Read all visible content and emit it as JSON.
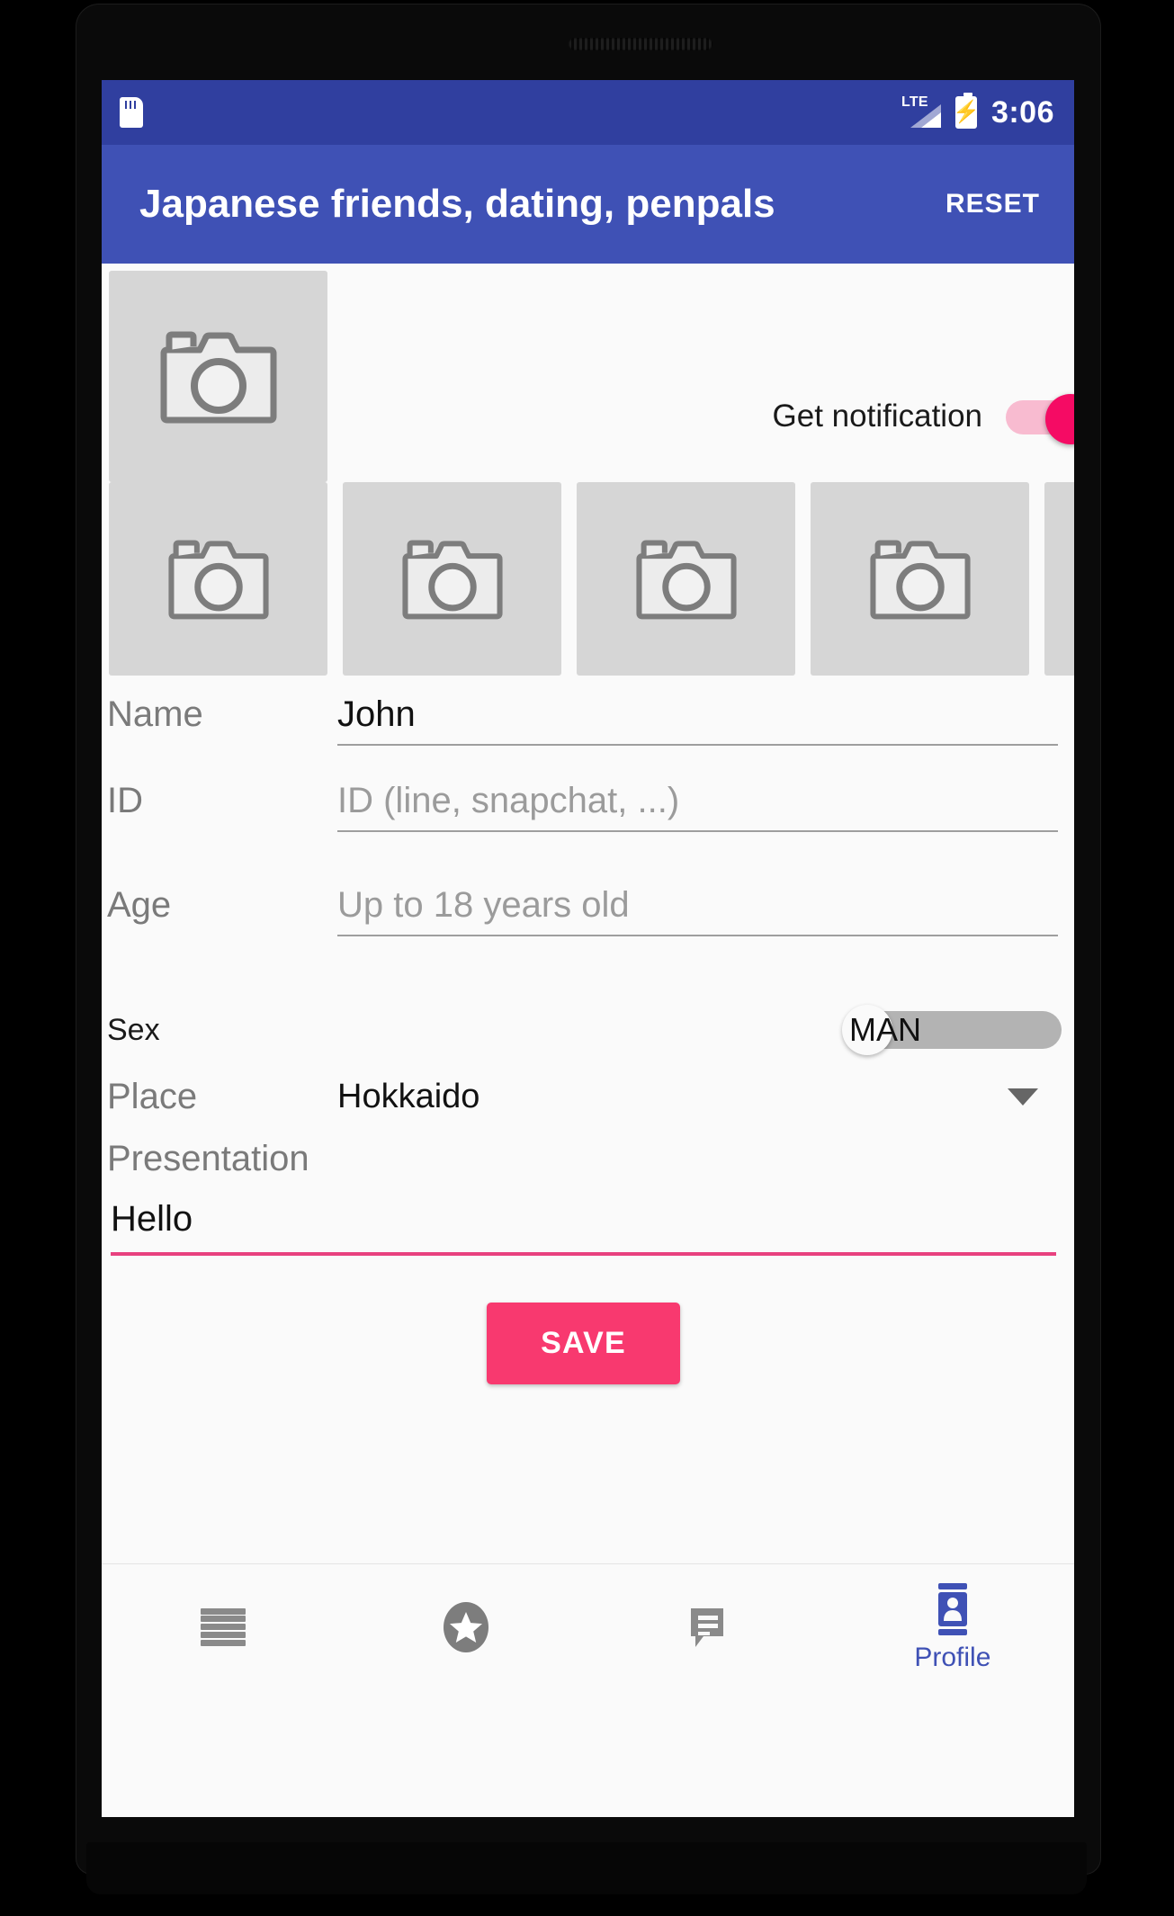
{
  "status_bar": {
    "sdcard_icon": "sd-card-icon",
    "network_label": "LTE",
    "signal_icon": "signal-bars-icon",
    "battery_icon": "battery-charging-icon",
    "time": "3:06"
  },
  "app_bar": {
    "title": "Japanese friends, dating, penpals",
    "reset_label": "RESET",
    "background_color": "#3f51b5"
  },
  "photos": {
    "main_placeholder_icon": "camera-icon",
    "thumbnails": [
      {
        "icon": "camera-icon"
      },
      {
        "icon": "camera-icon"
      },
      {
        "icon": "camera-icon"
      },
      {
        "icon": "camera-icon"
      },
      {
        "icon": "camera-icon"
      }
    ]
  },
  "notification": {
    "label": "Get notification",
    "state": "on",
    "accent_color": "#f50b64"
  },
  "form": {
    "name": {
      "label": "Name",
      "value": "John",
      "placeholder": "Name"
    },
    "id": {
      "label": "ID",
      "value": "",
      "placeholder": "ID (line, snapchat, ...)"
    },
    "age": {
      "label": "Age",
      "value": "",
      "placeholder": "Up to 18 years old"
    },
    "sex": {
      "label": "Sex",
      "value": "MAN",
      "state": "left"
    },
    "place": {
      "label": "Place",
      "value": "Hokkaido",
      "caret_icon": "chevron-down-icon"
    },
    "presentation": {
      "label": "Presentation",
      "value": "Hello",
      "underline_color": "#e8417f"
    },
    "save_label": "SAVE",
    "save_color": "#f8396f"
  },
  "bottom_nav": {
    "items": [
      {
        "label": "",
        "icon": "list-menu-icon",
        "active": false
      },
      {
        "label": "",
        "icon": "star-circle-icon",
        "active": false
      },
      {
        "label": "",
        "icon": "chat-bubble-icon",
        "active": false
      },
      {
        "label": "Profile",
        "icon": "contact-card-icon",
        "active": true
      }
    ],
    "active_color": "#3f51b5"
  }
}
